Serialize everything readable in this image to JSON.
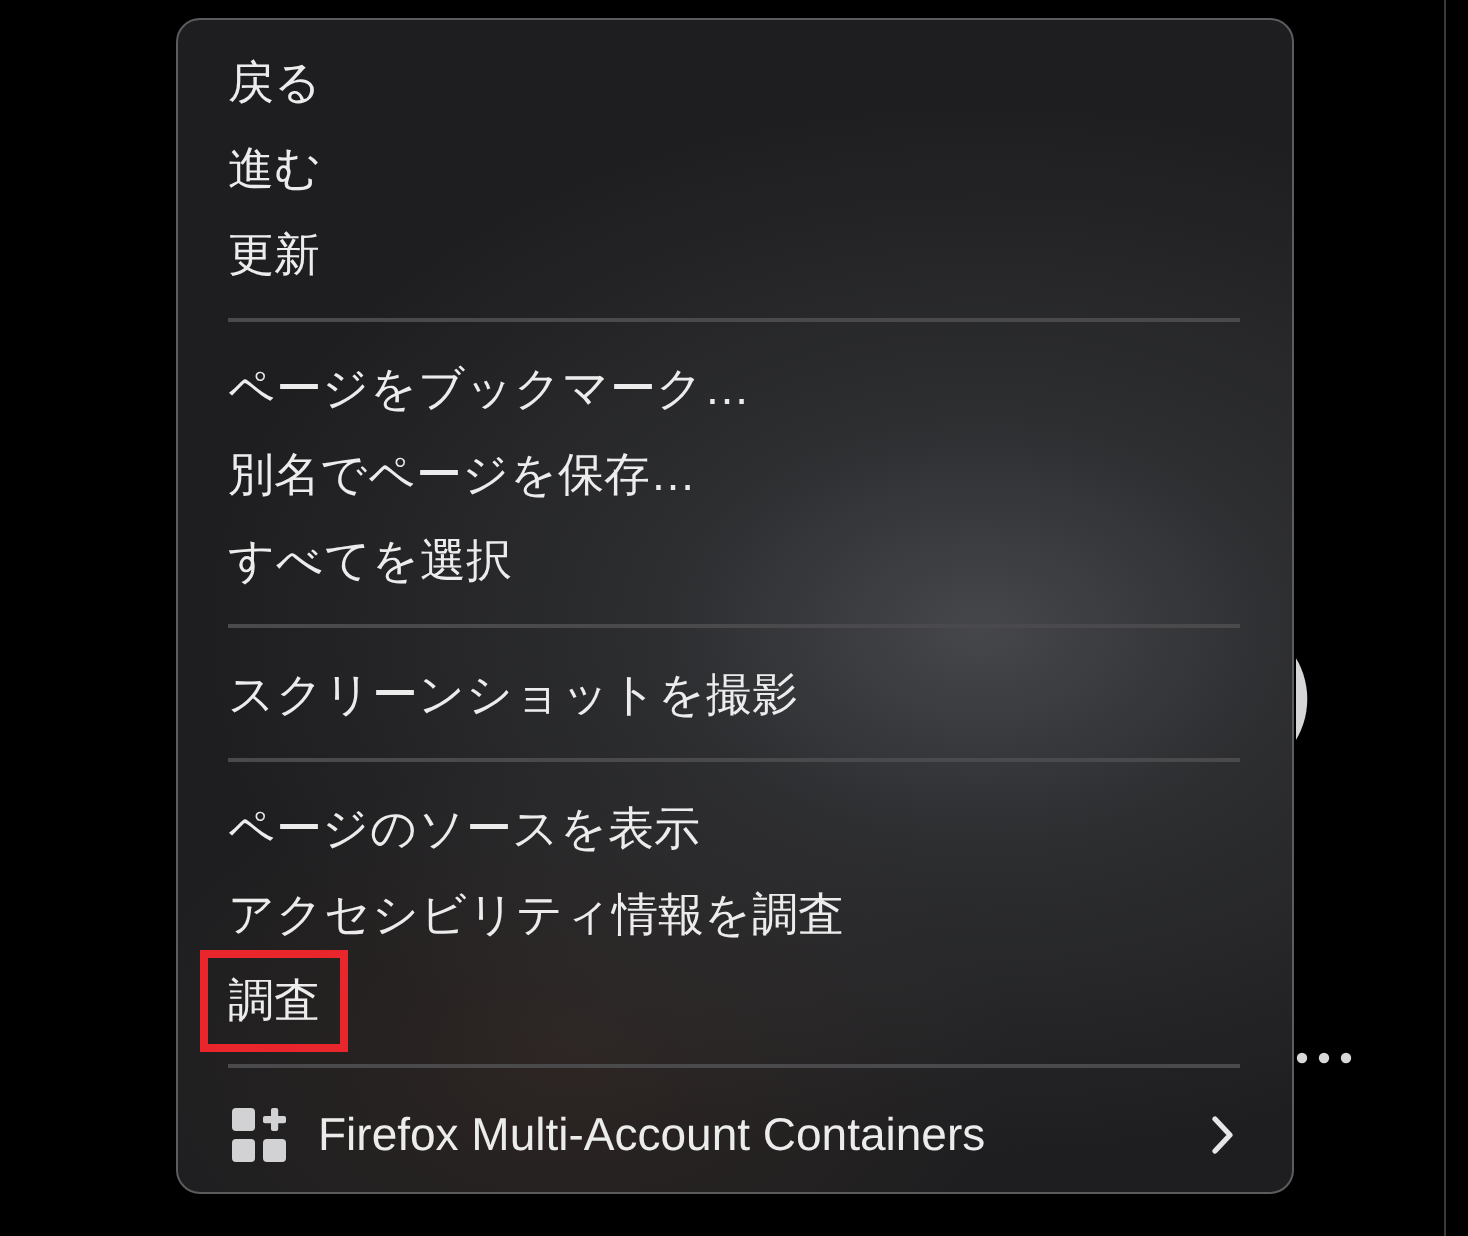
{
  "context_menu": {
    "sections": [
      {
        "items": [
          {
            "kind": "command",
            "label": "戻る",
            "highlighted": false
          },
          {
            "kind": "command",
            "label": "進む",
            "highlighted": false
          },
          {
            "kind": "command",
            "label": "更新",
            "highlighted": false
          }
        ]
      },
      {
        "items": [
          {
            "kind": "command",
            "label": "ページをブックマーク…",
            "highlighted": false
          },
          {
            "kind": "command",
            "label": "別名でページを保存…",
            "highlighted": false
          },
          {
            "kind": "command",
            "label": "すべてを選択",
            "highlighted": false
          }
        ]
      },
      {
        "items": [
          {
            "kind": "command",
            "label": "スクリーンショットを撮影",
            "highlighted": false
          }
        ]
      },
      {
        "items": [
          {
            "kind": "command",
            "label": "ページのソースを表示",
            "highlighted": false
          },
          {
            "kind": "command",
            "label": "アクセシビリティ情報を調査",
            "highlighted": false
          },
          {
            "kind": "command",
            "label": "調査",
            "highlighted": true
          }
        ]
      },
      {
        "items": [
          {
            "kind": "submenu",
            "label": "Firefox Multi-Account Containers",
            "highlighted": false
          }
        ]
      }
    ]
  }
}
